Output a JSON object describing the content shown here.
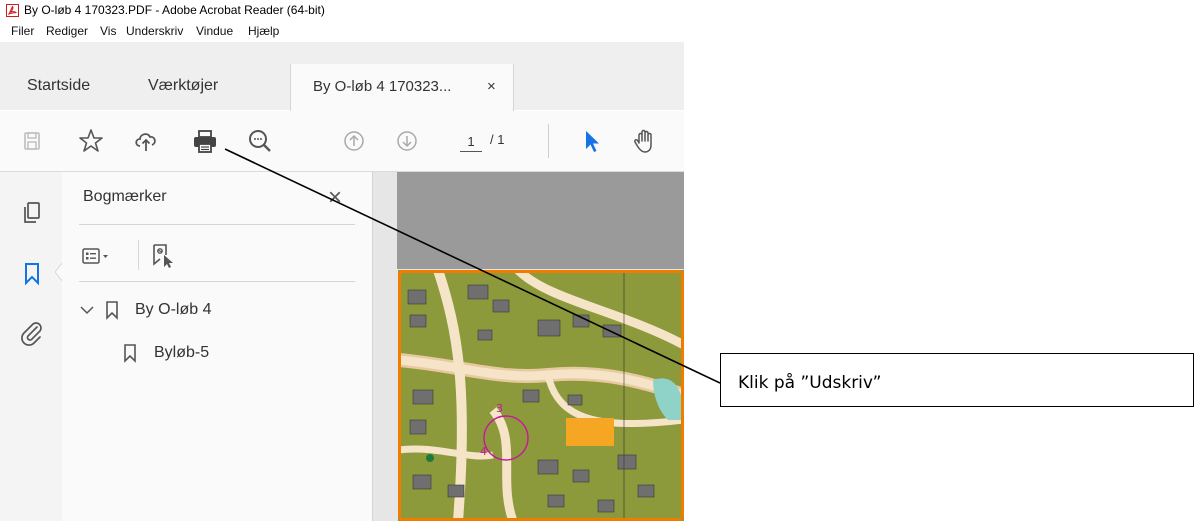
{
  "window": {
    "title": "By O-løb 4 170323.PDF - Adobe Acrobat Reader (64-bit)"
  },
  "menu": {
    "items": [
      "Filer",
      "Rediger",
      "Vis",
      "Underskriv",
      "Vindue",
      "Hjælp"
    ]
  },
  "tabs": {
    "home": "Startside",
    "tools": "Værktøjer",
    "document": "By O-løb 4 170323...",
    "close_symbol": "×"
  },
  "toolbar": {
    "page_current": "1",
    "page_total": "/ 1",
    "icons": [
      "save-icon",
      "star-icon",
      "cloud-upload-icon",
      "print-icon",
      "zoom-out-icon",
      "page-up-icon",
      "page-down-icon",
      "select-cursor-icon",
      "hand-tool-icon"
    ]
  },
  "panel": {
    "title": "Bogmærker",
    "close_symbol": "×",
    "bookmarks": [
      {
        "label": "By O-løb 4",
        "expanded": true
      },
      {
        "label": "Byløb-5"
      }
    ]
  },
  "callout": {
    "text": "Klik på ”Udskriv”"
  },
  "colors": {
    "accent_blue": "#1473e6",
    "map_border": "#f07d00",
    "map_green": "#8c9a3c"
  }
}
